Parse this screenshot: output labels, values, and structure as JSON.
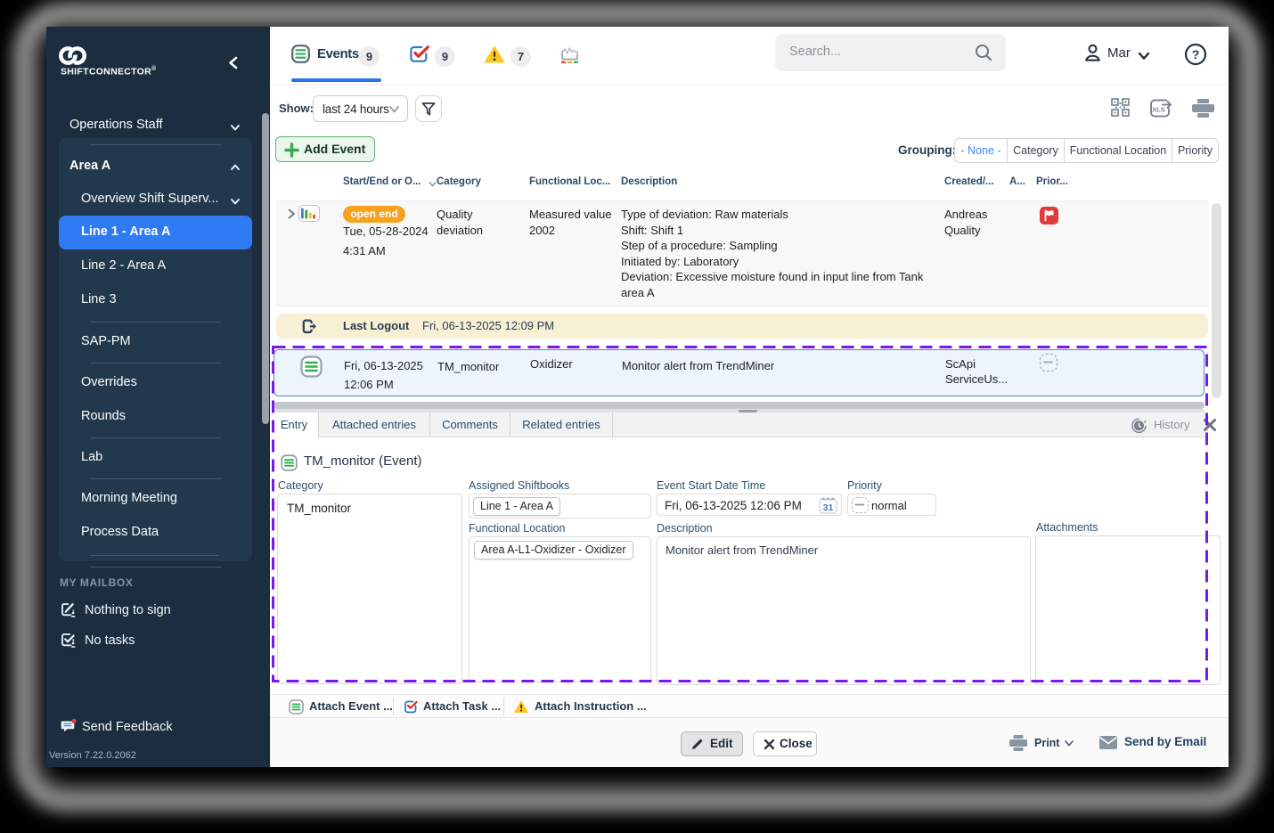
{
  "sidebar": {
    "brand": "SHIFTCONNECTOR",
    "brand_mark": "®",
    "operations": "Operations Staff",
    "area_title": "Area A",
    "items": {
      "overview": "Overview Shift Superv...",
      "line1": "Line 1 - Area A",
      "line2": "Line 2 - Area A",
      "line3": "Line 3",
      "sappm": "SAP-PM",
      "overrides": "Overrides",
      "rounds": "Rounds",
      "lab": "Lab",
      "morning": "Morning Meeting",
      "process": "Process Data"
    },
    "mailbox_header": "MY MAILBOX",
    "nothing_to_sign": "Nothing to sign",
    "no_tasks": "No tasks",
    "send_feedback": "Send Feedback",
    "version": "Version 7.22.0.2062"
  },
  "topbar": {
    "events_label": "Events",
    "events_count": "9",
    "tasks_count": "9",
    "warnings_count": "7",
    "search_placeholder": "Search...",
    "user": "Mar"
  },
  "toolbar": {
    "show_label": "Show:",
    "range_value": "last 24 hours",
    "add_event": "Add Event",
    "grouping_label": "Grouping:",
    "grouping": {
      "none": "- None -",
      "category": "Category",
      "functional": "Functional Location",
      "priority": "Priority"
    }
  },
  "table": {
    "headers": {
      "start": "Start/End or O...",
      "category": "Category",
      "functional": "Functional Loc...",
      "description": "Description",
      "created": "Created/...",
      "a": "A...",
      "priority": "Prior..."
    },
    "row1": {
      "badge": "open end",
      "date1": "Tue, 05-28-2024",
      "date2": "4:31 AM",
      "category": "Quality deviation",
      "functional": "Measured value 2002",
      "description": "Type of deviation: Raw materials\nShift: Shift 1\nStep of a procedure: Sampling\nInitiated by: Laboratory\nDeviation: Excessive moisture found in input line from Tank\narea A",
      "created": "Andreas Quality"
    },
    "logout": {
      "label": "Last Logout",
      "date": "Fri, 06-13-2025 12:09 PM"
    },
    "selected": {
      "date1": "Fri, 06-13-2025",
      "date2": "12:06 PM",
      "category": "TM_monitor",
      "functional": "Oxidizer",
      "description": "Monitor alert from TrendMiner",
      "created1": "ScApi",
      "created2": "ServiceUs..."
    }
  },
  "detail": {
    "tabs": {
      "entry": "Entry",
      "attached": "Attached entries",
      "comments": "Comments",
      "related": "Related entries"
    },
    "history": "History",
    "title": "TM_monitor (Event)",
    "labels": {
      "category": "Category",
      "shiftbooks": "Assigned Shiftbooks",
      "start": "Event Start Date Time",
      "priority": "Priority",
      "functional": "Functional Location",
      "description": "Description",
      "attachments": "Attachments"
    },
    "values": {
      "category": "TM_monitor",
      "shiftbooks": "Line 1 - Area A",
      "start": "Fri, 06-13-2025 12:06 PM",
      "calendar_day": "31",
      "priority": "normal",
      "functional": "Area A-L1-Oxidizer - Oxidizer",
      "description": "Monitor alert from TrendMiner"
    }
  },
  "footer": {
    "attach_event": "Attach Event ...",
    "attach_task": "Attach Task ...",
    "attach_instruction": "Attach Instruction ...",
    "edit": "Edit",
    "close": "Close",
    "print": "Print",
    "send_by_email": "Send by Email"
  }
}
